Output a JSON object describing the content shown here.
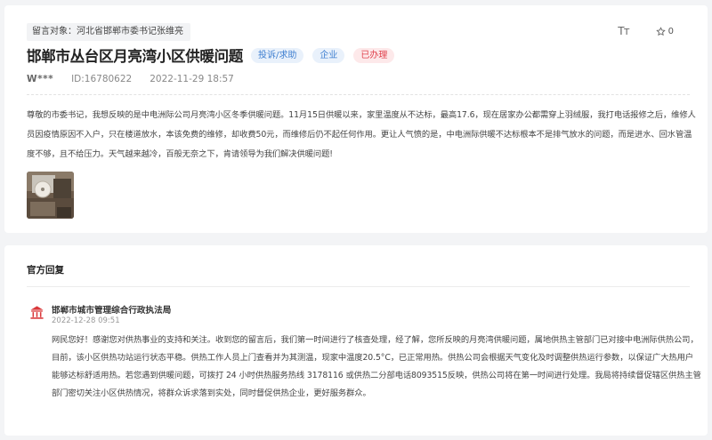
{
  "message": {
    "addressee": "留言对象：河北省邯郸市委书记张维亮",
    "tools": {
      "font_label": "Tт",
      "like_count": "0"
    },
    "title": "邯郸市丛台区月亮湾小区供暖问题",
    "tags": {
      "type": "投诉/求助",
      "field": "企业",
      "status": "已办理"
    },
    "author": "W***",
    "id": "ID:16780622",
    "date": "2022-11-29 18:57",
    "content": "尊敬的市委书记，我想反映的是中电洲际公司月亮湾小区冬季供暖问题。11月15日供暖以来，家里温度从不达标，最高17.6，现在居家办公都需穿上羽绒服，我打电话报修之后，维修人员因疫情原因不入户，只在楼道放水，本该免费的维修，却收费50元，而维修后仍不起任何作用。更让人气愤的是，中电洲际供暖不达标根本不是排气放水的问题，而是进水、回水管温度不够，且不给压力。天气越来越冷，百般无奈之下，肯请领导为我们解决供暖问题!"
  },
  "reply": {
    "section_title": "官方回复",
    "department": "邯郸市城市管理综合行政执法局",
    "date": "2022-12-28 09:51",
    "content": "网民您好！感谢您对供热事业的支持和关注。收到您的留言后，我们第一时间进行了核查处理，经了解，您所反映的月亮湾供暖问题，属地供热主管部门已对接中电洲际供热公司，目前，该小区供热功站运行状态平稳。供热工作人员上门查看并为其测温，现家中温度20.5°C，已正常用热。供热公司会根据天气变化及时调整供热运行参数，以保证广大热用户能够达标舒适用热。若您遇到供暖问题，可拨打 24 小时供热服务热线 3178116 或供热二分部电话8093515反映，供热公司将在第一时间进行处理。我局将持续督促辖区供热主管部门密切关注小区供热情况，将群众诉求落到实处，同时督促供热企业，更好服务群众。"
  },
  "colors": {
    "accent_blue": "#3f7fd0",
    "status_red": "#e0434e",
    "dept_icon_red": "#d9383a"
  }
}
